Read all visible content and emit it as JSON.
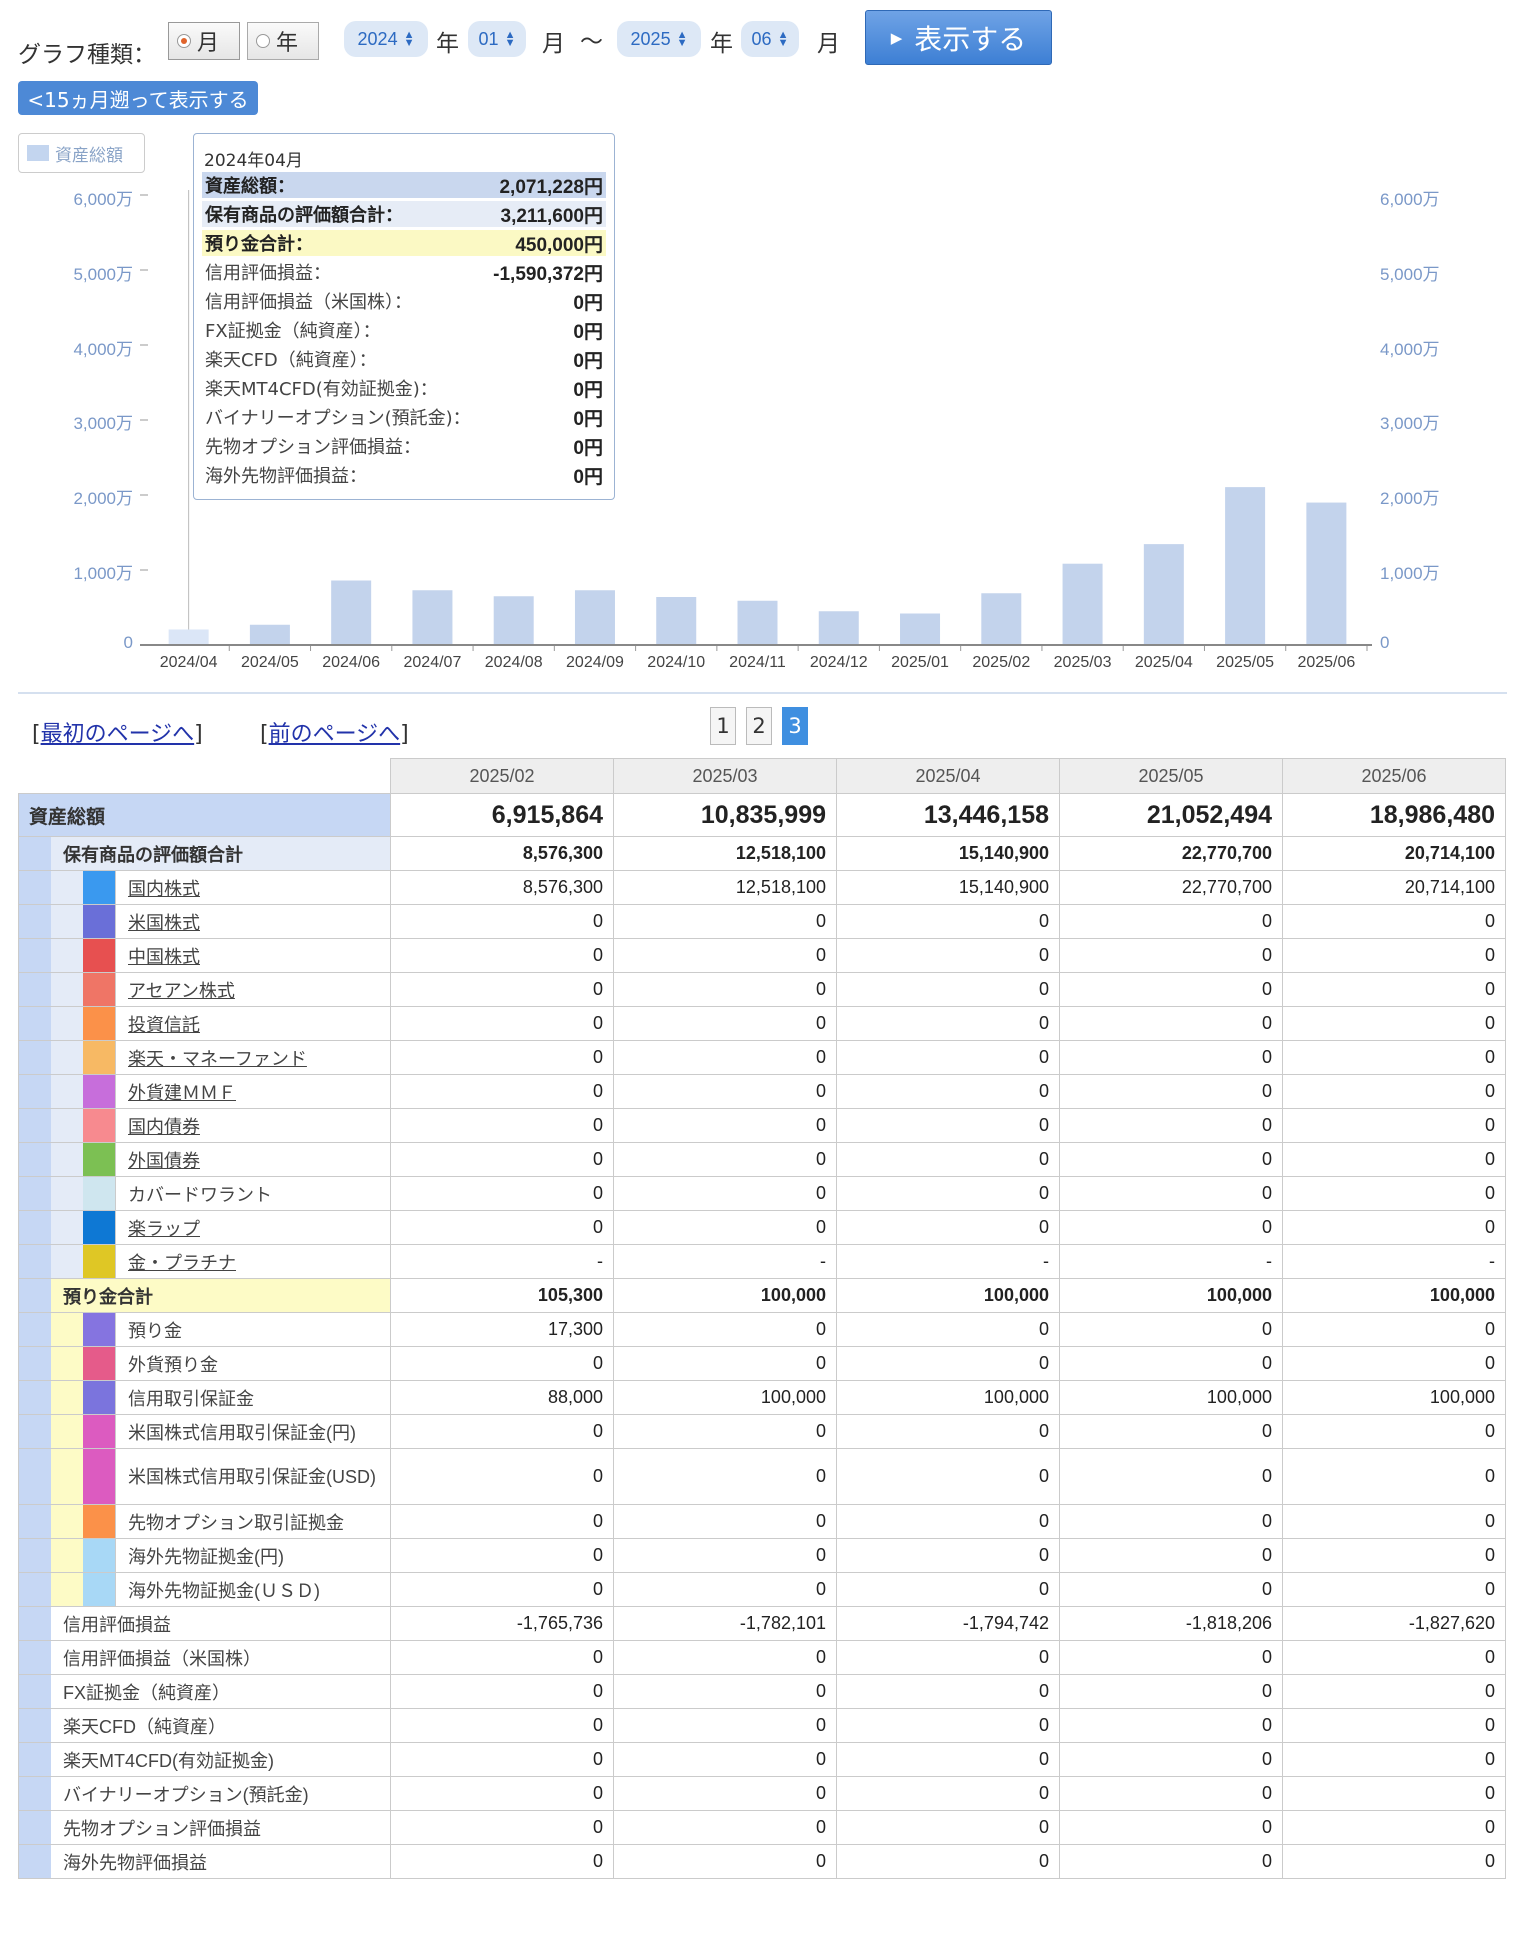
{
  "controls": {
    "graph_type_label": "グラフ種類：",
    "radio_month": "月",
    "radio_year": "年",
    "start_year": "2024",
    "start_month": "01",
    "end_year": "2025",
    "end_month": "06",
    "year_unit": "年",
    "month_unit": "月",
    "tilde": "〜",
    "show_button": "表示する",
    "back_button": "<15ヵ月遡って表示する"
  },
  "legend_label": "資産総額",
  "chart_data": {
    "type": "bar",
    "categories": [
      "2024/04",
      "2024/05",
      "2024/06",
      "2024/07",
      "2024/08",
      "2024/09",
      "2024/10",
      "2024/11",
      "2024/12",
      "2025/01",
      "2025/02",
      "2025/03",
      "2025/04",
      "2025/05",
      "2025/06"
    ],
    "series": [
      {
        "name": "資産総額",
        "values": [
          207,
          270,
          860,
          730,
          650,
          730,
          640,
          590,
          450,
          420,
          690,
          1084,
          1345,
          2105,
          1899
        ]
      }
    ],
    "unit": "万",
    "ylim": [
      0,
      6000
    ],
    "yticks": [
      "0",
      "1,000万",
      "2,000万",
      "3,000万",
      "4,000万",
      "5,000万",
      "6,000万"
    ],
    "highlight_index": 0,
    "grid": false,
    "legend": "top-left"
  },
  "tooltip": {
    "title": "2024年04月",
    "rows": [
      {
        "label": "資産総額：",
        "value": "2,071,228円",
        "style": "total"
      },
      {
        "label": "保有商品の評価額合計：",
        "value": "3,211,600円",
        "style": "holding"
      },
      {
        "label": "預り金合計：",
        "value": "450,000円",
        "style": "deposit"
      },
      {
        "label": "信用評価損益：",
        "value": "-1,590,372円",
        "style": "plain"
      },
      {
        "label": "信用評価損益（米国株）：",
        "value": "0円",
        "style": "plain"
      },
      {
        "label": "FX証拠金（純資産）：",
        "value": "0円",
        "style": "plain"
      },
      {
        "label": "楽天CFD（純資産）：",
        "value": "0円",
        "style": "plain"
      },
      {
        "label": "楽天MT4CFD(有効証拠金)：",
        "value": "0円",
        "style": "plain"
      },
      {
        "label": "バイナリーオプション(預託金)：",
        "value": "0円",
        "style": "plain"
      },
      {
        "label": "先物オプション評価損益：",
        "value": "0円",
        "style": "plain"
      },
      {
        "label": "海外先物評価損益：",
        "value": "0円",
        "style": "plain"
      }
    ]
  },
  "pager": {
    "first": "最初のページへ",
    "prev": "前のページへ",
    "pages": [
      "1",
      "2",
      "3"
    ],
    "current": "3",
    "bl": "[",
    "br": "]"
  },
  "table": {
    "headers": [
      "2025/02",
      "2025/03",
      "2025/04",
      "2025/05",
      "2025/06"
    ],
    "total": {
      "label": "資産総額",
      "values": [
        "6,915,864",
        "10,835,999",
        "13,446,158",
        "21,052,494",
        "18,986,480"
      ]
    },
    "holding": {
      "label": "保有商品の評価額合計",
      "values": [
        "8,576,300",
        "12,518,100",
        "15,140,900",
        "22,770,700",
        "20,714,100"
      ],
      "items": [
        {
          "label": "国内株式",
          "color": "#3a99ef",
          "link": true,
          "values": [
            "8,576,300",
            "12,518,100",
            "15,140,900",
            "22,770,700",
            "20,714,100"
          ]
        },
        {
          "label": "米国株式",
          "color": "#6a6fd8",
          "link": true,
          "values": [
            "0",
            "0",
            "0",
            "0",
            "0"
          ]
        },
        {
          "label": "中国株式",
          "color": "#e75050",
          "link": true,
          "values": [
            "0",
            "0",
            "0",
            "0",
            "0"
          ]
        },
        {
          "label": "アセアン株式",
          "color": "#ef7566",
          "link": true,
          "values": [
            "0",
            "0",
            "0",
            "0",
            "0"
          ]
        },
        {
          "label": "投資信託",
          "color": "#fb9149",
          "link": true,
          "values": [
            "0",
            "0",
            "0",
            "0",
            "0"
          ]
        },
        {
          "label": "楽天・マネーファンド",
          "color": "#f7b964",
          "link": true,
          "values": [
            "0",
            "0",
            "0",
            "0",
            "0"
          ]
        },
        {
          "label": "外貨建ＭＭＦ",
          "color": "#c76edb",
          "link": true,
          "values": [
            "0",
            "0",
            "0",
            "0",
            "0"
          ]
        },
        {
          "label": "国内債券",
          "color": "#f78a8f",
          "link": true,
          "values": [
            "0",
            "0",
            "0",
            "0",
            "0"
          ]
        },
        {
          "label": "外国債券",
          "color": "#7cc053",
          "link": true,
          "values": [
            "0",
            "0",
            "0",
            "0",
            "0"
          ]
        },
        {
          "label": "カバードワラント",
          "color": "#cfe6ef",
          "link": false,
          "values": [
            "0",
            "0",
            "0",
            "0",
            "0"
          ]
        },
        {
          "label": "楽ラップ",
          "color": "#0e78d4",
          "link": true,
          "values": [
            "0",
            "0",
            "0",
            "0",
            "0"
          ]
        },
        {
          "label": "金・プラチナ",
          "color": "#dfc725",
          "link": true,
          "values": [
            "-",
            "-",
            "-",
            "-",
            "-"
          ]
        }
      ]
    },
    "deposit": {
      "label": "預り金合計",
      "values": [
        "105,300",
        "100,000",
        "100,000",
        "100,000",
        "100,000"
      ],
      "items": [
        {
          "label": "預り金",
          "color": "#8574e0",
          "values": [
            "17,300",
            "0",
            "0",
            "0",
            "0"
          ]
        },
        {
          "label": "外貨預り金",
          "color": "#e55b8a",
          "values": [
            "0",
            "0",
            "0",
            "0",
            "0"
          ]
        },
        {
          "label": "信用取引保証金",
          "color": "#7b74dd",
          "values": [
            "88,000",
            "100,000",
            "100,000",
            "100,000",
            "100,000"
          ]
        },
        {
          "label": "米国株式信用取引保証金(円)",
          "color": "#dc5bc0",
          "values": [
            "0",
            "0",
            "0",
            "0",
            "0"
          ]
        },
        {
          "label": "米国株式信用取引保証金(USD)",
          "color": "#dc5bc0",
          "tall": true,
          "values": [
            "0",
            "0",
            "0",
            "0",
            "0"
          ]
        },
        {
          "label": "先物オプション取引証拠金",
          "color": "#fb9149",
          "values": [
            "0",
            "0",
            "0",
            "0",
            "0"
          ]
        },
        {
          "label": "海外先物証拠金(円)",
          "color": "#a8d8f6",
          "values": [
            "0",
            "0",
            "0",
            "0",
            "0"
          ]
        },
        {
          "label": "海外先物証拠金(ＵＳＤ)",
          "color": "#a8d8f6",
          "values": [
            "0",
            "0",
            "0",
            "0",
            "0"
          ]
        }
      ]
    },
    "others": [
      {
        "label": "信用評価損益",
        "values": [
          "-1,765,736",
          "-1,782,101",
          "-1,794,742",
          "-1,818,206",
          "-1,827,620"
        ]
      },
      {
        "label": "信用評価損益（米国株）",
        "values": [
          "0",
          "0",
          "0",
          "0",
          "0"
        ]
      },
      {
        "label": "FX証拠金（純資産）",
        "values": [
          "0",
          "0",
          "0",
          "0",
          "0"
        ]
      },
      {
        "label": "楽天CFD（純資産）",
        "values": [
          "0",
          "0",
          "0",
          "0",
          "0"
        ]
      },
      {
        "label": "楽天MT4CFD(有効証拠金)",
        "values": [
          "0",
          "0",
          "0",
          "0",
          "0"
        ]
      },
      {
        "label": "バイナリーオプション(預託金)",
        "values": [
          "0",
          "0",
          "0",
          "0",
          "0"
        ]
      },
      {
        "label": "先物オプション評価損益",
        "values": [
          "0",
          "0",
          "0",
          "0",
          "0"
        ]
      },
      {
        "label": "海外先物評価損益",
        "values": [
          "0",
          "0",
          "0",
          "0",
          "0"
        ]
      }
    ]
  }
}
